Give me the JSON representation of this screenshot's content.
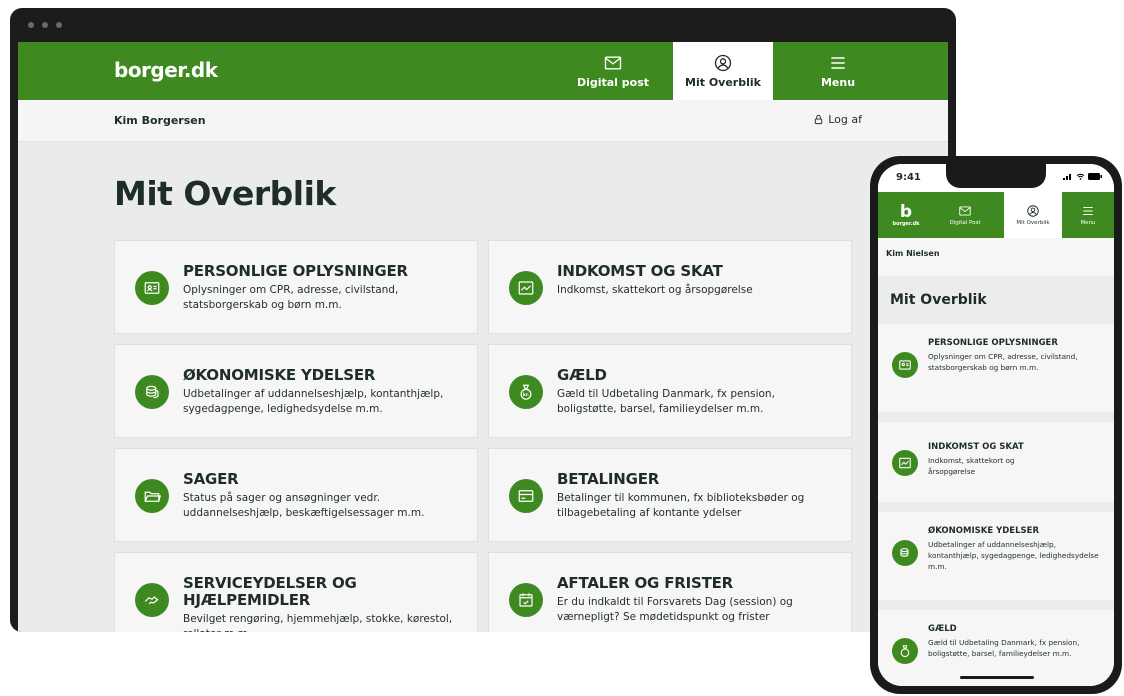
{
  "desktop": {
    "nav": {
      "logo": "borger.dk",
      "digital_post": "Digital post",
      "mit_overblik": "Mit Overblik",
      "menu": "Menu"
    },
    "user": {
      "name": "Kim Borgersen",
      "logout": "Log af"
    },
    "page_title": "Mit Overblik",
    "cards": [
      {
        "title": "PERSONLIGE OPLYSNINGER",
        "desc": "Oplysninger om CPR, adresse, civilstand, statsborgerskab og børn m.m.",
        "icon": "id-card-icon"
      },
      {
        "title": "INDKOMST OG SKAT",
        "desc": "Indkomst, skattekort og årsopgørelse",
        "icon": "chart-icon"
      },
      {
        "title": "ØKONOMISKE YDELSER",
        "desc": "Udbetalinger af uddannelseshjælp, kontanthjælp, sygedagpenge, ledighedsydelse m.m.",
        "icon": "coins-icon"
      },
      {
        "title": "GÆLD",
        "desc": "Gæld til Udbetaling Danmark, fx pension, boligstøtte, barsel, familieydelser m.m.",
        "icon": "money-bag-icon"
      },
      {
        "title": "SAGER",
        "desc": "Status på sager og ansøgninger vedr. uddannelseshjælp, beskæftigelsessager m.m.",
        "icon": "folder-icon"
      },
      {
        "title": "BETALINGER",
        "desc": "Betalinger til kommunen, fx biblioteksbøder og tilbagebetaling af kontante ydelser",
        "icon": "card-icon"
      },
      {
        "title": "SERVICEYDELSER OG HJÆLPEMIDLER",
        "desc": "Bevilget rengøring, hjemmehjælp, stokke, kørestol, rollator m.m.",
        "icon": "helping-hand-icon"
      },
      {
        "title": "AFTALER OG FRISTER",
        "desc": "Er du indkaldt til Forsvarets Dag (session) og værnepligt? Se mødetidspunkt og frister",
        "icon": "calendar-icon"
      }
    ]
  },
  "mobile": {
    "time": "9:41",
    "nav": {
      "logo_letter": "b",
      "logo": "borger.dk",
      "digital_post": "Digital Post",
      "mit_overblik": "Mit Overblik",
      "menu": "Menu"
    },
    "user": {
      "name": "Kim Nielsen"
    },
    "page_title": "Mit Overblik",
    "cards": [
      {
        "title": "PERSONLIGE OPLYSNINGER",
        "desc": "Oplysninger om CPR, adresse, civilstand, statsborgerskab og børn m.m."
      },
      {
        "title": "INDKOMST OG SKAT",
        "desc": "Indkomst, skattekort og årsopgørelse"
      },
      {
        "title": "ØKONOMISKE YDELSER",
        "desc": "Udbetalinger af uddannelseshjælp, kontanthjælp, sygedagpenge, ledighedsydelse m.m."
      },
      {
        "title": "GÆLD",
        "desc": "Gæld til Udbetaling Danmark, fx pension, boligstøtte, barsel, familieydelser m.m."
      }
    ]
  },
  "colors": {
    "brand_green": "#3f8a20",
    "text_dark": "#1e2d2a",
    "background": "#eaebec",
    "card": "#f6f6f6"
  }
}
